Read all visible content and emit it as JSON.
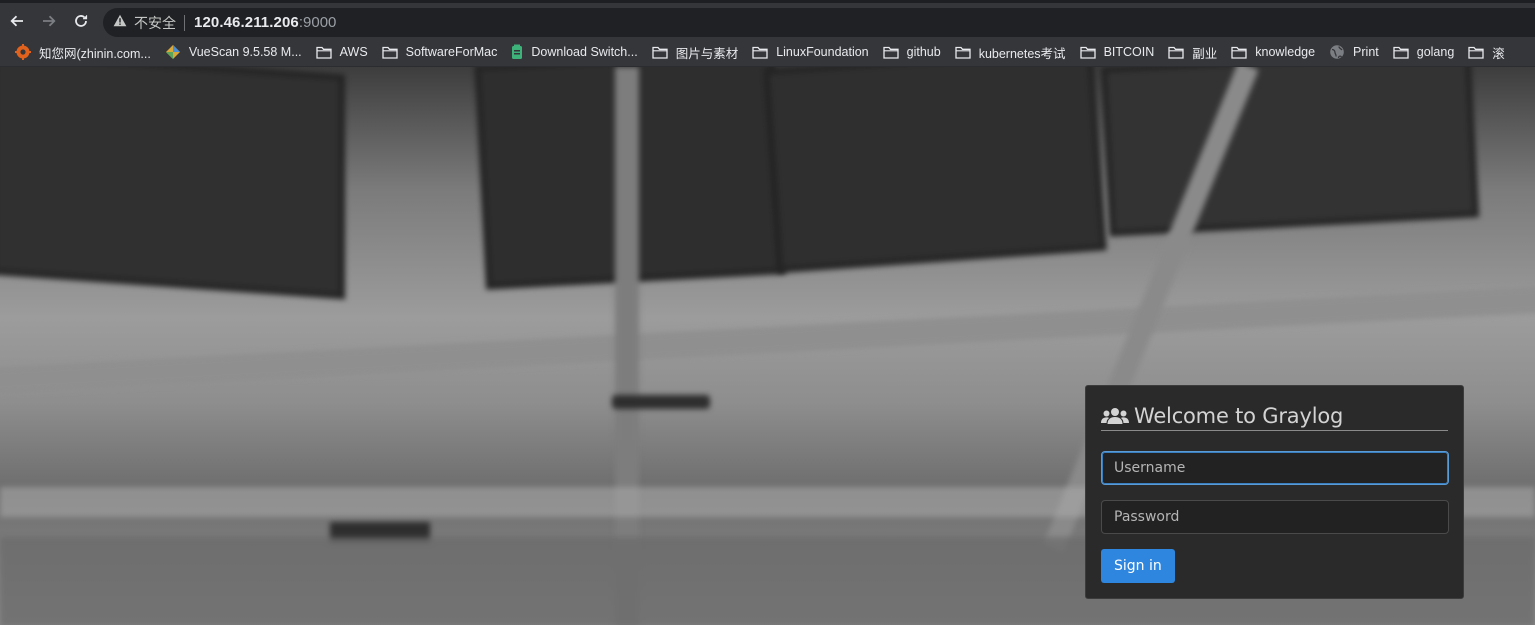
{
  "browser": {
    "security_label": "不安全",
    "url_host": "120.46.211.206",
    "url_port": ":9000",
    "bookmarks": [
      {
        "label": "知您网(zhinin.com...",
        "icon": "zhinin-favicon"
      },
      {
        "label": "VueScan 9.5.58 M...",
        "icon": "vuescan-favicon"
      },
      {
        "label": "AWS",
        "icon": "folder-icon"
      },
      {
        "label": "SoftwareForMac",
        "icon": "folder-icon"
      },
      {
        "label": "Download Switch...",
        "icon": "download-favicon"
      },
      {
        "label": "图片与素材",
        "icon": "folder-icon"
      },
      {
        "label": "LinuxFoundation",
        "icon": "folder-icon"
      },
      {
        "label": "github",
        "icon": "folder-icon"
      },
      {
        "label": "kubernetes考试",
        "icon": "folder-icon"
      },
      {
        "label": "BITCOIN",
        "icon": "folder-icon"
      },
      {
        "label": "副业",
        "icon": "folder-icon"
      },
      {
        "label": "knowledge",
        "icon": "folder-icon"
      },
      {
        "label": "Print",
        "icon": "globe-icon"
      },
      {
        "label": "golang",
        "icon": "folder-icon"
      },
      {
        "label": "滚",
        "icon": "folder-icon"
      }
    ]
  },
  "login": {
    "title": "Welcome to Graylog",
    "username_placeholder": "Username",
    "password_placeholder": "Password",
    "signin_label": "Sign in",
    "accent_color": "#2e86de"
  }
}
